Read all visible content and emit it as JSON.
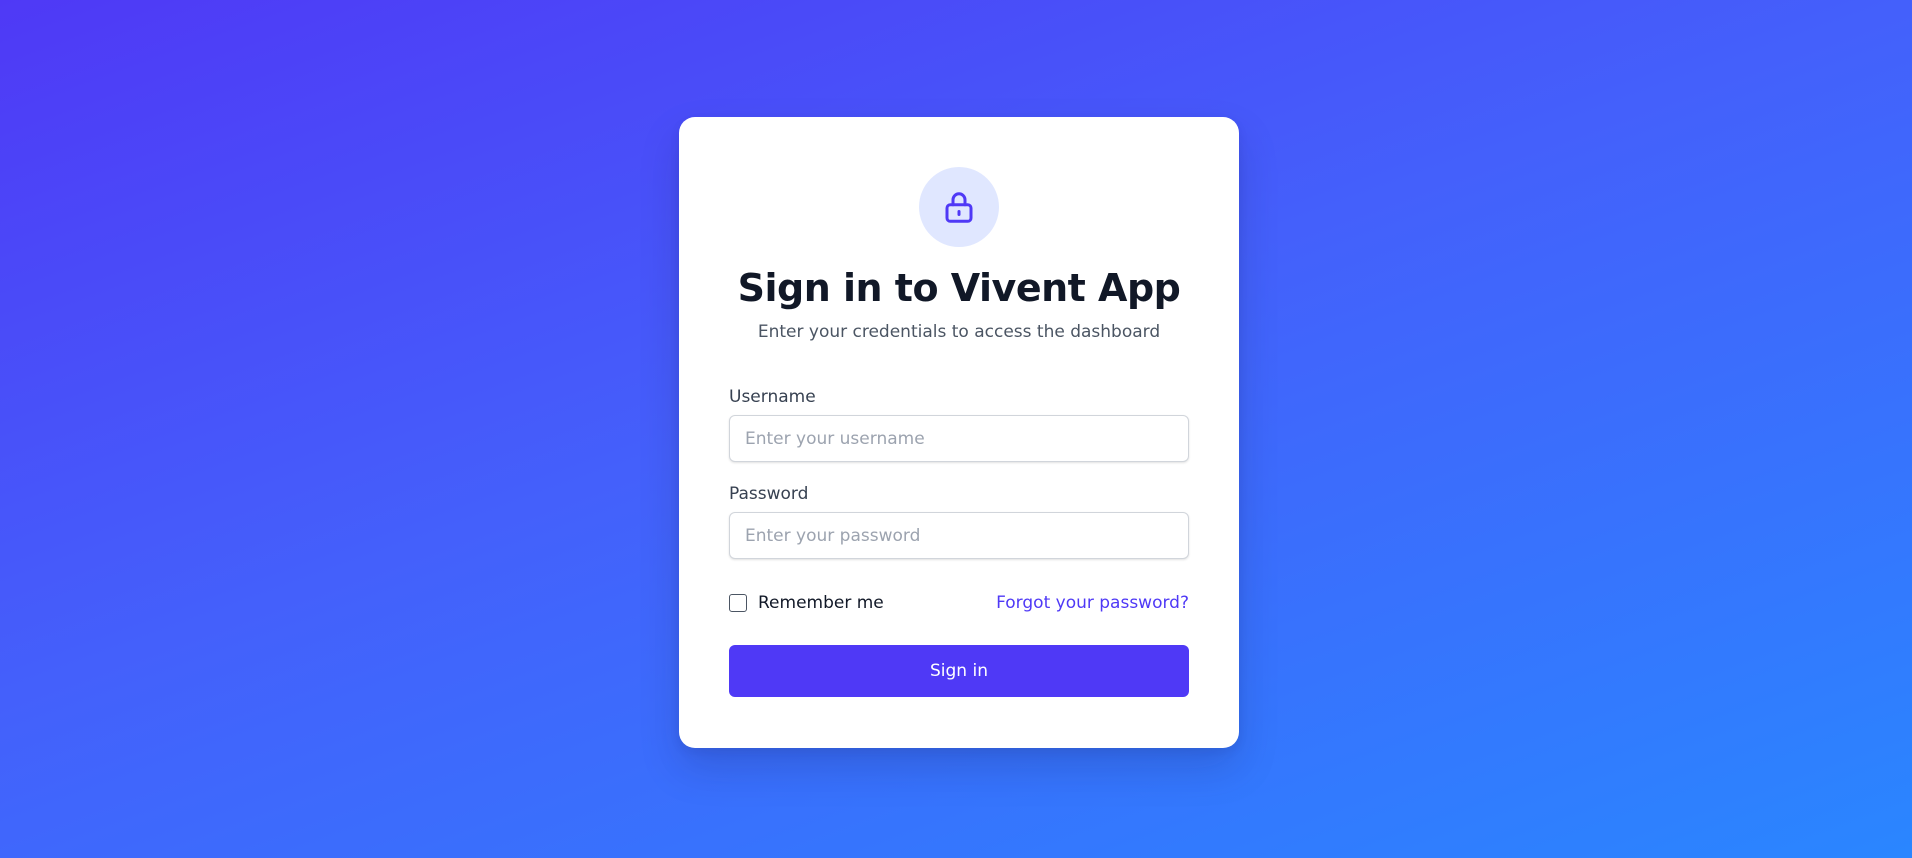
{
  "header": {
    "icon": "lock-icon",
    "title": "Sign in to Vivent App",
    "subtitle": "Enter your credentials to access the dashboard"
  },
  "form": {
    "username": {
      "label": "Username",
      "value": "",
      "placeholder": "Enter your username"
    },
    "password": {
      "label": "Password",
      "value": "",
      "placeholder": "Enter your password"
    },
    "remember_me": {
      "label": "Remember me",
      "checked": false
    },
    "forgot_link": "Forgot your password?",
    "submit_label": "Sign in"
  },
  "colors": {
    "accent": "#4f39f6",
    "icon_bg": "#e0e7ff",
    "background_start": "#4f39f6",
    "background_end": "#2a86ff"
  }
}
